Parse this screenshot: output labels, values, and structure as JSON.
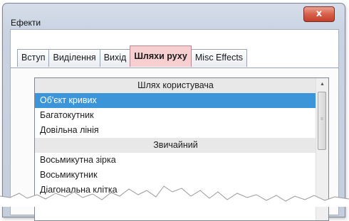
{
  "window": {
    "title": "Ефекти",
    "close_label": "x"
  },
  "tabs": [
    {
      "label": "Вступ",
      "active": false
    },
    {
      "label": "Виділення",
      "active": false
    },
    {
      "label": "Вихід",
      "active": false
    },
    {
      "label": "Шляхи руху",
      "active": true
    },
    {
      "label": "Misc Effects",
      "active": false
    }
  ],
  "list": {
    "rows": [
      {
        "text": "Шлях користувача",
        "kind": "header"
      },
      {
        "text": "Об'єкт кривих",
        "kind": "selected"
      },
      {
        "text": "Багатокутник",
        "kind": "item"
      },
      {
        "text": "Довільна лінія",
        "kind": "item"
      },
      {
        "text": "Звичайний",
        "kind": "header"
      },
      {
        "text": "Восьмикутна зірка",
        "kind": "item"
      },
      {
        "text": "Восьмикутник",
        "kind": "item"
      },
      {
        "text": "Діагональна клітка",
        "kind": "item"
      }
    ]
  },
  "icons": {
    "scroll_up": "scroll-up-arrow-icon",
    "close": "close-icon"
  },
  "colors": {
    "selection": "#3c95d9",
    "active_tab": "#f8cfd1",
    "close_button": "#d7604a"
  }
}
